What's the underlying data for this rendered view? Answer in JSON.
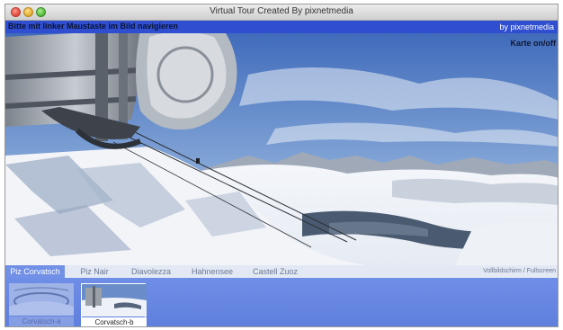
{
  "window": {
    "title": "Virtual Tour Created By pixnetmedia"
  },
  "infobar": {
    "hint": "Bitte mit linker Maustaste im Bild navigieren",
    "brand": "by pixnetmedia"
  },
  "map_toggle": "Karte on/off",
  "tabs": [
    {
      "label": "Piz Corvatsch",
      "active": true
    },
    {
      "label": "Piz Nair",
      "active": false
    },
    {
      "label": "Diavolezza",
      "active": false
    },
    {
      "label": "Hahnensee",
      "active": false
    },
    {
      "label": "Castell Zuoz",
      "active": false
    }
  ],
  "fullscreen": "Vollbildschirm / Fullscreen",
  "thumbnails": [
    {
      "label": "Corvatsch-a",
      "active": false
    },
    {
      "label": "Corvatsch-b",
      "active": true
    }
  ],
  "colors": {
    "infobar": "#2f4fd0",
    "tab_active": "#7190e6",
    "thumb_strip": "#6f8ee7"
  }
}
